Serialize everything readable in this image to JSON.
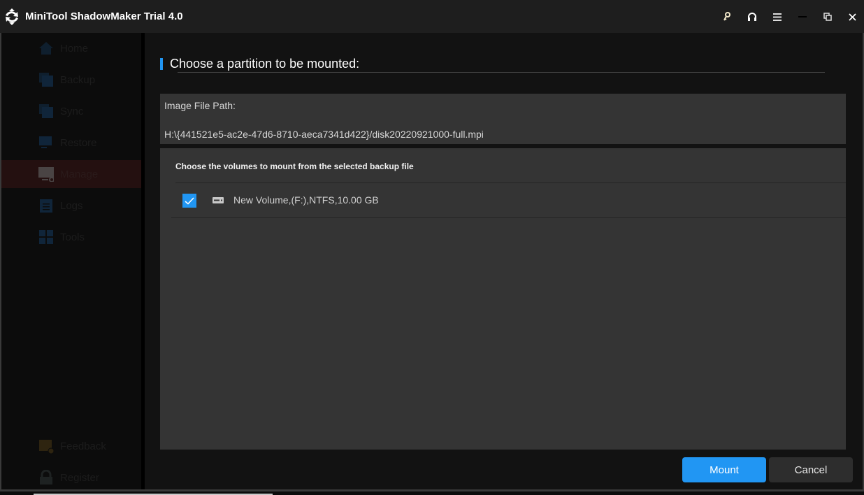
{
  "app": {
    "title": "MiniTool ShadowMaker Trial 4.0",
    "logo_icon": "minitool-logo-icon"
  },
  "titlebar": {
    "buttons": [
      {
        "name": "key-icon",
        "label": "Register key"
      },
      {
        "name": "headset-icon",
        "label": "Support"
      },
      {
        "name": "menu-icon",
        "label": "Menu"
      },
      {
        "name": "minimize-icon",
        "label": "Minimize"
      },
      {
        "name": "restore-icon",
        "label": "Restore"
      },
      {
        "name": "close-icon",
        "label": "Close"
      }
    ]
  },
  "sidebar": {
    "items": [
      {
        "label": "Home",
        "icon": "home-icon"
      },
      {
        "label": "Backup",
        "icon": "backup-icon"
      },
      {
        "label": "Sync",
        "icon": "sync-icon"
      },
      {
        "label": "Restore",
        "icon": "restore-icon"
      },
      {
        "label": "Manage",
        "icon": "manage-icon",
        "active": true
      },
      {
        "label": "Logs",
        "icon": "logs-icon"
      },
      {
        "label": "Tools",
        "icon": "tools-icon"
      }
    ],
    "bottom_items": [
      {
        "label": "Feedback",
        "icon": "feedback-icon"
      },
      {
        "label": "Register",
        "icon": "lock-icon"
      }
    ]
  },
  "dialog": {
    "title": "Choose a partition to be mounted:",
    "image_file_path_label": "Image File Path:",
    "image_file_path": "H:\\{441521e5-ac2e-47d6-8710-aeca7341d422}/disk20220921000-full.mpi",
    "volumes_header": "Choose the volumes to mount from the selected backup file",
    "volumes": [
      {
        "label": "New Volume,(F:),NTFS,10.00 GB",
        "checked": true,
        "icon": "drive-icon"
      }
    ],
    "mount_label": "Mount",
    "cancel_label": "Cancel"
  },
  "colors": {
    "accent": "#2196f3",
    "panel": "#343434",
    "background": "#121212"
  }
}
